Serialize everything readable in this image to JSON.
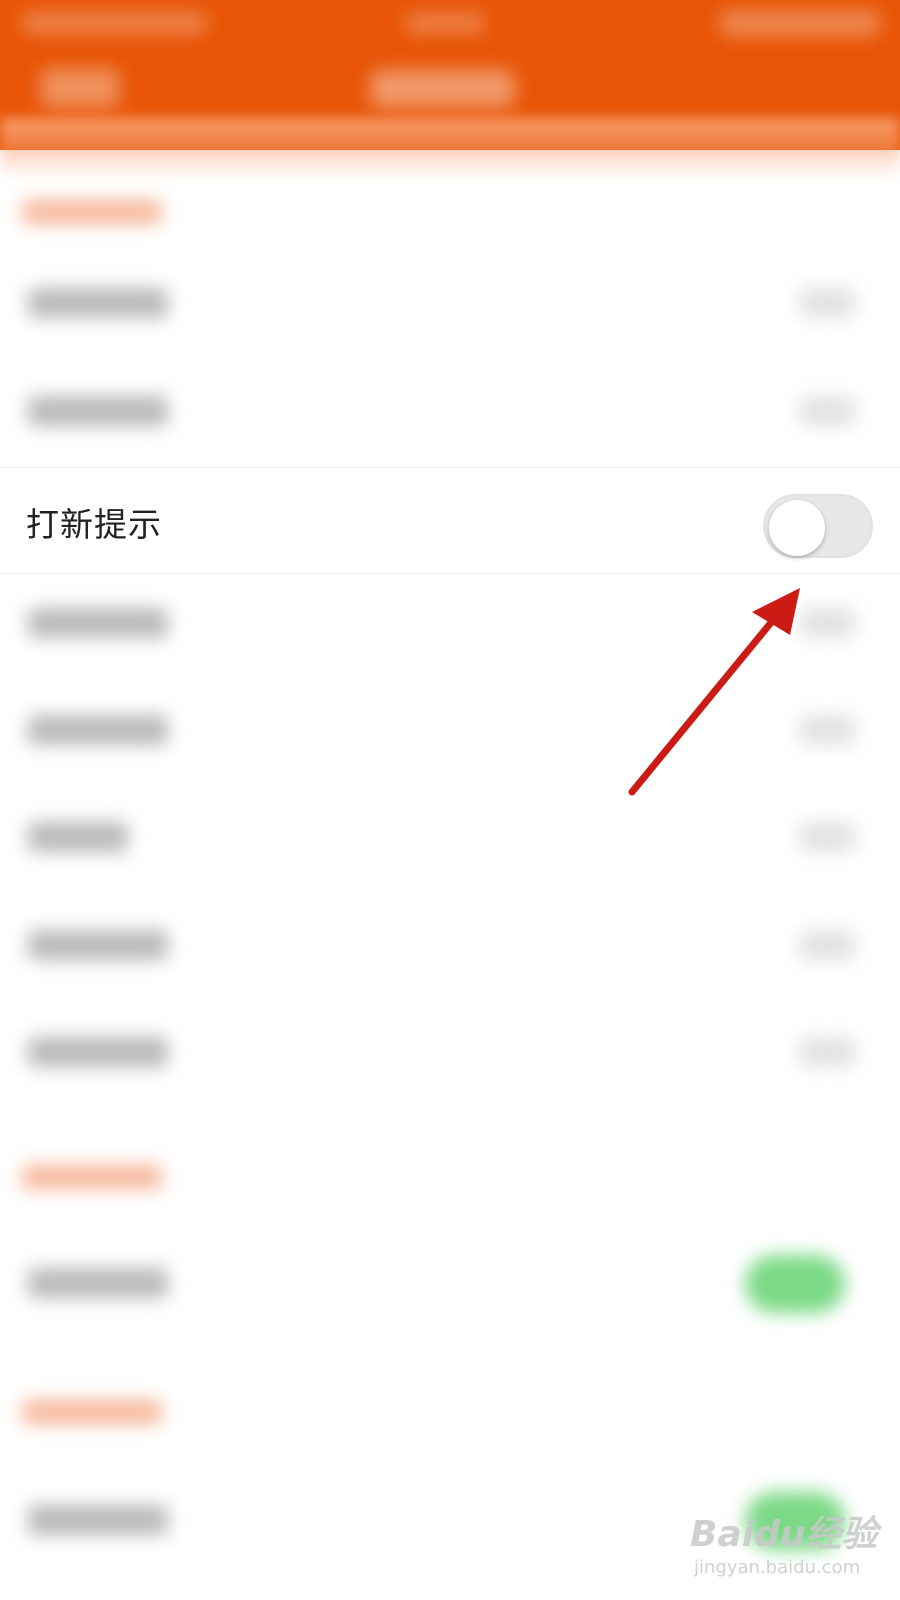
{
  "header": {
    "bg_color": "#e85507"
  },
  "settings": {
    "active_item": {
      "label": "打新提示",
      "toggle_state": "off"
    }
  },
  "annotation": {
    "arrow_color": "#cc1a14",
    "direction": "points-to-toggle"
  },
  "watermark": {
    "logo_text": "Baidu经验",
    "sub_text": "jingyan.baidu.com"
  },
  "colors": {
    "accent": "#e85507",
    "toggle_on": "#7bd987",
    "toggle_off": "#e7e7e7"
  }
}
